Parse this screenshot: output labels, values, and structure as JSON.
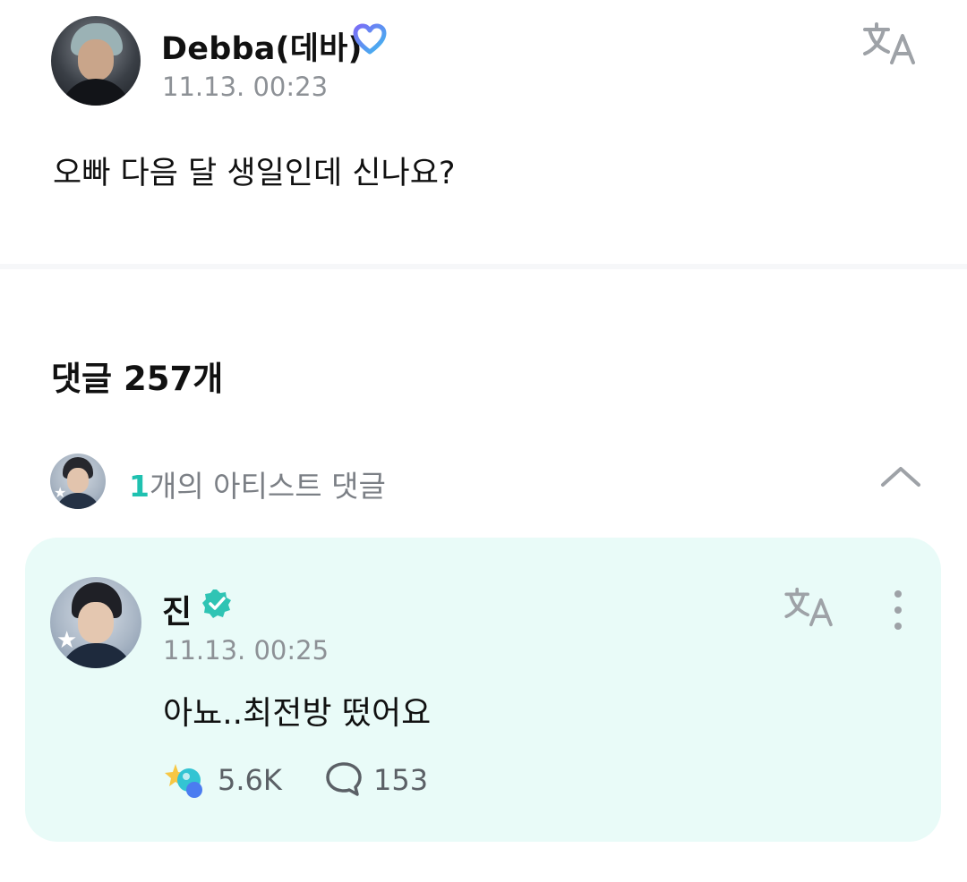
{
  "post": {
    "author": "Debba(데바)",
    "badge_icon": "heart-badge-icon",
    "timestamp": "11.13. 00:23",
    "text": "오빠 다음 달 생일인데 신나요?"
  },
  "comments": {
    "heading": "댓글 257개",
    "artist_section": {
      "count": "1",
      "label": "개의 아티스트 댓글"
    }
  },
  "artist_comment": {
    "name": "진",
    "timestamp": "11.13. 00:25",
    "text": "아뇨..최전방 떴어요",
    "likes": "5.6K",
    "replies": "153"
  },
  "colors": {
    "accent": "#1fc1b0",
    "card_background": "#e9fbf8",
    "muted_text": "#8d9196"
  }
}
